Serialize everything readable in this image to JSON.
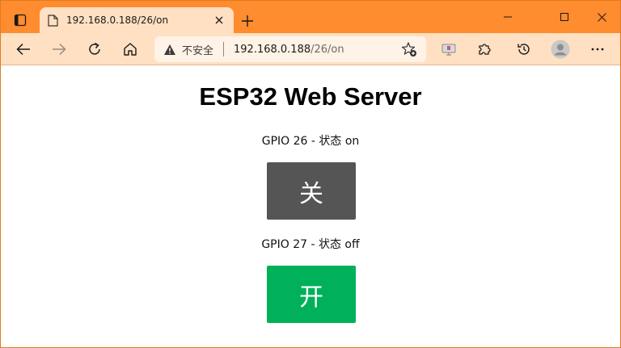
{
  "browser": {
    "tab": {
      "title": "192.168.0.188/26/on"
    },
    "address": {
      "security_label": "不安全",
      "url_host": "192.168.0.188",
      "url_path": "/26/on"
    }
  },
  "page": {
    "title": "ESP32 Web Server",
    "gpios": [
      {
        "label": "GPIO 26 - 状态 on",
        "button_label": "关",
        "button_color": "#555555"
      },
      {
        "label": "GPIO 27 - 状态 off",
        "button_label": "开",
        "button_color": "#00b15a"
      }
    ]
  },
  "colors": {
    "title_bar": "#ff8c2e",
    "toolbar": "#ffe0c2"
  }
}
